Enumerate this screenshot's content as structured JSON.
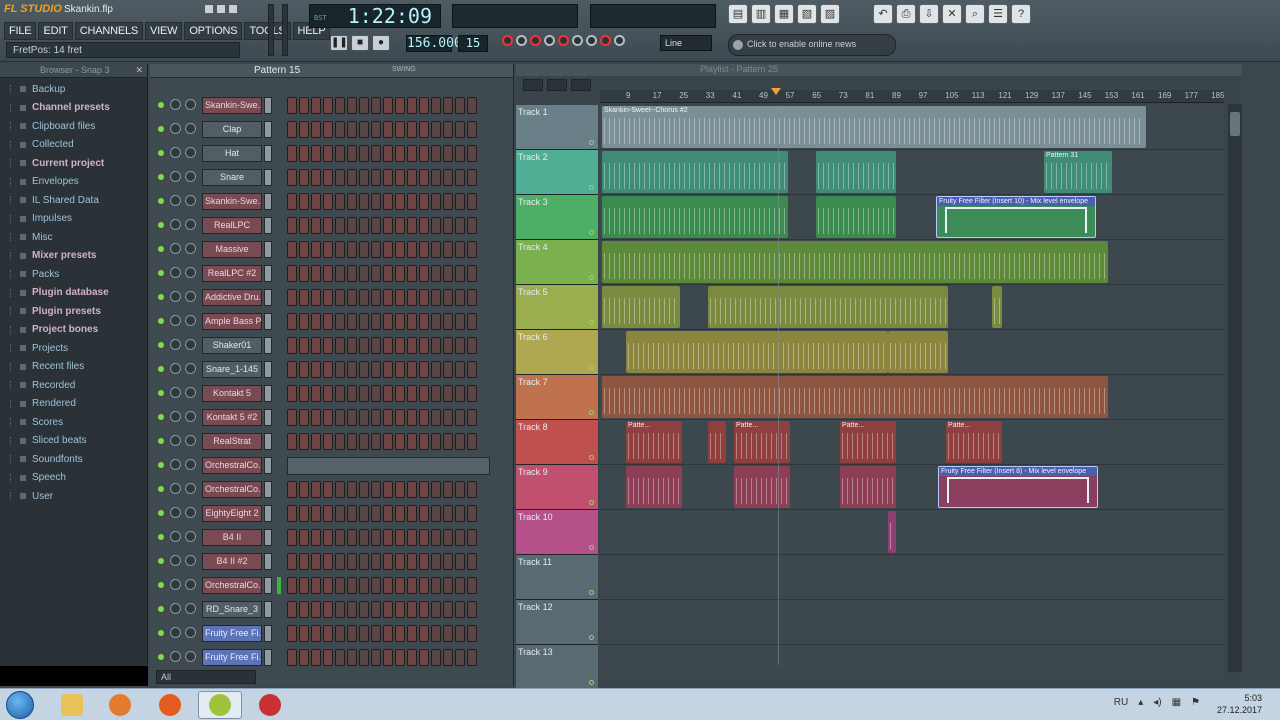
{
  "app": {
    "logo": "FL STUDIO",
    "project_file": "Skankin.flp",
    "hint": "FretPos: 14 fret",
    "menu": [
      "FILE",
      "EDIT",
      "CHANNELS",
      "VIEW",
      "OPTIONS",
      "TOOLS",
      "HELP"
    ]
  },
  "transport": {
    "time": "1:22:09",
    "tempo": "156.000",
    "pattern_number": "15",
    "snap": "Line",
    "online_news": "Click to enable online news",
    "time_label": "BST"
  },
  "browser": {
    "title": "Browser - Snap 3",
    "items": [
      {
        "label": "Backup",
        "style": "blue"
      },
      {
        "label": "Channel presets",
        "style": "bold"
      },
      {
        "label": "Clipboard files",
        "style": "blue"
      },
      {
        "label": "Collected",
        "style": "blue"
      },
      {
        "label": "Current project",
        "style": "bold"
      },
      {
        "label": "Envelopes",
        "style": "blue"
      },
      {
        "label": "IL Shared Data",
        "style": "blue"
      },
      {
        "label": "Impulses",
        "style": "blue"
      },
      {
        "label": "Misc",
        "style": "blue"
      },
      {
        "label": "Mixer presets",
        "style": "bold"
      },
      {
        "label": "Packs",
        "style": "blue"
      },
      {
        "label": "Plugin database",
        "style": "bold"
      },
      {
        "label": "Plugin presets",
        "style": "bold"
      },
      {
        "label": "Project bones",
        "style": "bold"
      },
      {
        "label": "Projects",
        "style": "blue"
      },
      {
        "label": "Recent files",
        "style": "blue"
      },
      {
        "label": "Recorded",
        "style": "blue"
      },
      {
        "label": "Rendered",
        "style": "blue"
      },
      {
        "label": "Scores",
        "style": "blue"
      },
      {
        "label": "Sliced beats",
        "style": "blue"
      },
      {
        "label": "Soundfonts",
        "style": "blue"
      },
      {
        "label": "Speech",
        "style": "blue"
      },
      {
        "label": "User",
        "style": "blue"
      }
    ]
  },
  "rack": {
    "pattern": "Pattern 15",
    "swing_label": "SWING",
    "filter": "All",
    "channels": [
      {
        "name": "Skankin-Swe...",
        "style": "red"
      },
      {
        "name": "Clap",
        "style": "grey"
      },
      {
        "name": "Hat",
        "style": "grey"
      },
      {
        "name": "Snare",
        "style": "grey"
      },
      {
        "name": "Skankin-Swe...",
        "style": "red"
      },
      {
        "name": "RealLPC",
        "style": "red"
      },
      {
        "name": "Massive",
        "style": "red"
      },
      {
        "name": "RealLPC #2",
        "style": "red"
      },
      {
        "name": "Addictive Dru...",
        "style": "red"
      },
      {
        "name": "Ample Bass P...",
        "style": "red"
      },
      {
        "name": "Shaker01",
        "style": "grey"
      },
      {
        "name": "Snare_1-145",
        "style": "grey"
      },
      {
        "name": "Kontakt 5",
        "style": "red"
      },
      {
        "name": "Kontakt 5 #2",
        "style": "red"
      },
      {
        "name": "RealStrat",
        "style": "red"
      },
      {
        "name": "OrchestralCo...",
        "style": "red"
      },
      {
        "name": "OrchestralCo...",
        "style": "red"
      },
      {
        "name": "EightyEight 2",
        "style": "red"
      },
      {
        "name": "B4 II",
        "style": "red"
      },
      {
        "name": "B4 II #2",
        "style": "red"
      },
      {
        "name": "OrchestralCo...",
        "style": "red"
      },
      {
        "name": "RD_Snare_3",
        "style": "grey"
      },
      {
        "name": "Fruity Free Fi...",
        "style": "blue"
      },
      {
        "name": "Fruity Free Fi...",
        "style": "blue"
      }
    ]
  },
  "playlist": {
    "title": "Playlist - Pattern 25",
    "ruler": [
      "9",
      "17",
      "25",
      "33",
      "41",
      "49",
      "57",
      "65",
      "73",
      "81",
      "89",
      "97",
      "105",
      "113",
      "121",
      "129",
      "137",
      "145",
      "153",
      "161",
      "169",
      "177",
      "185"
    ],
    "tracks": [
      {
        "name": "Track 1",
        "color": "#6a8088"
      },
      {
        "name": "Track 2",
        "color": "#4fae93"
      },
      {
        "name": "Track 3",
        "color": "#4fae66"
      },
      {
        "name": "Track 4",
        "color": "#7bb04f"
      },
      {
        "name": "Track 5",
        "color": "#9aae50"
      },
      {
        "name": "Track 6",
        "color": "#b0a850"
      },
      {
        "name": "Track 7",
        "color": "#c0714e"
      },
      {
        "name": "Track 8",
        "color": "#c0504e"
      },
      {
        "name": "Track 9",
        "color": "#c0506e"
      },
      {
        "name": "Track 10",
        "color": "#b6508a"
      },
      {
        "name": "Track 11",
        "color": "#596a72"
      },
      {
        "name": "Track 12",
        "color": "#596a72"
      },
      {
        "name": "Track 13",
        "color": "#596a72"
      }
    ],
    "clip_labels": {
      "track1_audio": "Skankin-Sweet--Chorus #2",
      "track2_pattern": "Pattern 31",
      "track3_auto": "Fruity Free Filter (Insert 10) - Mix level envelope",
      "track8_patterns": "Patte...",
      "track9_auto": "Fruity Free Filter (Insert 8) - Mix level envelope"
    }
  },
  "taskbar": {
    "lang": "RU",
    "time": "5:03",
    "date": "27.12.2017"
  }
}
